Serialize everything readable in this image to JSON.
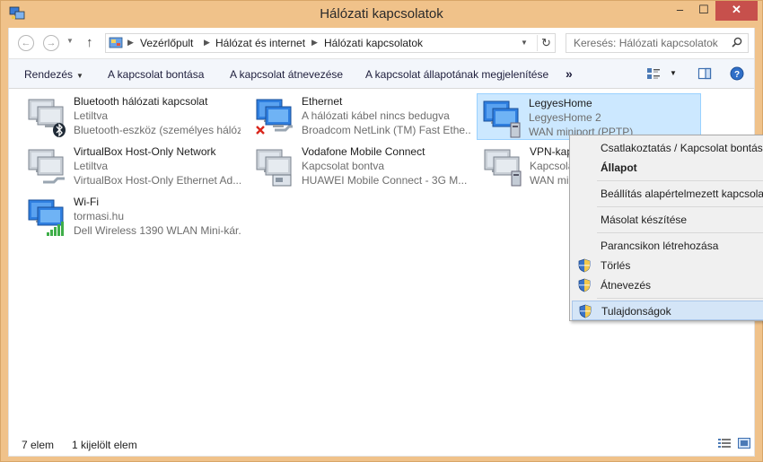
{
  "window": {
    "title": "Hálózati kapcsolatok",
    "min_glyph": "–",
    "max_glyph": "☐",
    "close_glyph": "✕"
  },
  "address": {
    "breadcrumbs": [
      "Vezérlőpult",
      "Hálózat és internet",
      "Hálózati kapcsolatok"
    ],
    "search_placeholder": "Keresés: Hálózati kapcsolatok"
  },
  "toolbar": {
    "organize": "Rendezés",
    "disconnect": "A kapcsolat bontása",
    "rename": "A kapcsolat átnevezése",
    "status": "A kapcsolat állapotának megjelenítése",
    "more": "»"
  },
  "connections": [
    {
      "name": "Bluetooth hálózati kapcsolat",
      "status": "Letiltva",
      "device": "Bluetooth-eszköz (személyes hálózat)",
      "icon": "bluetooth-network-icon"
    },
    {
      "name": "Ethernet",
      "status": "A hálózati kábel nincs bedugva",
      "device": "Broadcom NetLink (TM) Fast Ethe...",
      "icon": "ethernet-disconnected-icon"
    },
    {
      "name": "LegyesHome",
      "status": "LegyesHome  2",
      "device": "WAN miniport (PPTP)",
      "icon": "vpn-connection-icon"
    },
    {
      "name": "VirtualBox Host-Only Network",
      "status": "Letiltva",
      "device": "VirtualBox Host-Only Ethernet Ad...",
      "icon": "ethernet-adapter-icon"
    },
    {
      "name": "Vodafone Mobile Connect",
      "status": "Kapcsolat bontva",
      "device": "HUAWEI Mobile Connect - 3G M...",
      "icon": "modem-connection-icon"
    },
    {
      "name": "VPN-kapcsolat",
      "status": "Kapcsolat bontva",
      "device": "WAN miniport (PPTP)",
      "icon": "vpn-connection-icon"
    },
    {
      "name": "Wi-Fi",
      "status": "tormasi.hu",
      "device": "Dell Wireless 1390 WLAN Mini-kár...",
      "icon": "wifi-signal-icon"
    }
  ],
  "statusbar": {
    "count": "7 elem",
    "selected": "1 kijelölt elem"
  },
  "context_menu": {
    "connect": "Csatlakoztatás / Kapcsolat bontása",
    "status": "Állapot",
    "set_default": "Beállítás alapértelmezett kapcsolatként",
    "copy": "Másolat készítése",
    "shortcut": "Parancsikon létrehozása",
    "delete": "Törlés",
    "rename": "Átnevezés",
    "properties": "Tulajdonságok"
  },
  "colors": {
    "titlebar": "#f0c28a",
    "close_button": "#c7504c",
    "selection": "#cce8ff",
    "menu_highlight": "#d4e5f7"
  }
}
